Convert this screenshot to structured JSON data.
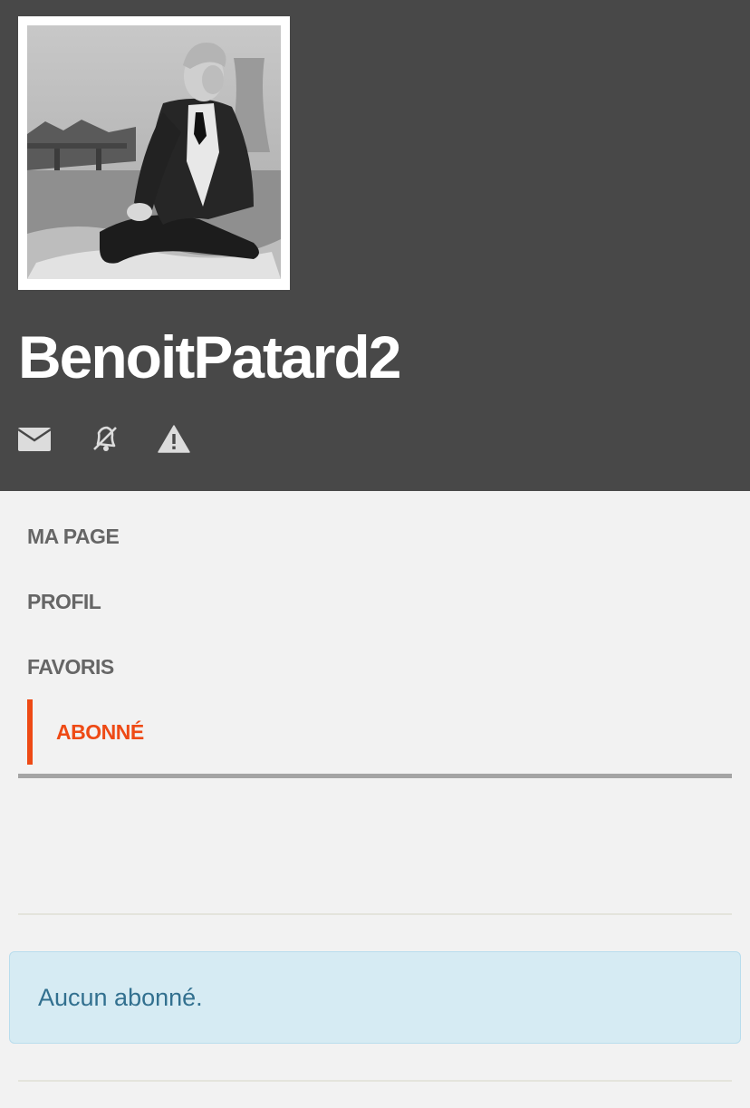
{
  "profile": {
    "username": "BenoitPatard2",
    "avatar": "profile-photo"
  },
  "actions": [
    {
      "icon": "envelope-icon"
    },
    {
      "icon": "bell-slash-icon"
    },
    {
      "icon": "warning-icon"
    }
  ],
  "nav": {
    "items": [
      {
        "label": "MA PAGE"
      },
      {
        "label": "PROFIL"
      },
      {
        "label": "FAVORIS"
      },
      {
        "label": "ABONNÉ"
      }
    ],
    "active": "ABONNÉ"
  },
  "colors": {
    "header_bg": "#484848",
    "accent": "#ee4a15",
    "alert_bg": "#d6ebf3",
    "alert_text": "#32708f"
  },
  "alert": {
    "message": "Aucun abonné."
  }
}
